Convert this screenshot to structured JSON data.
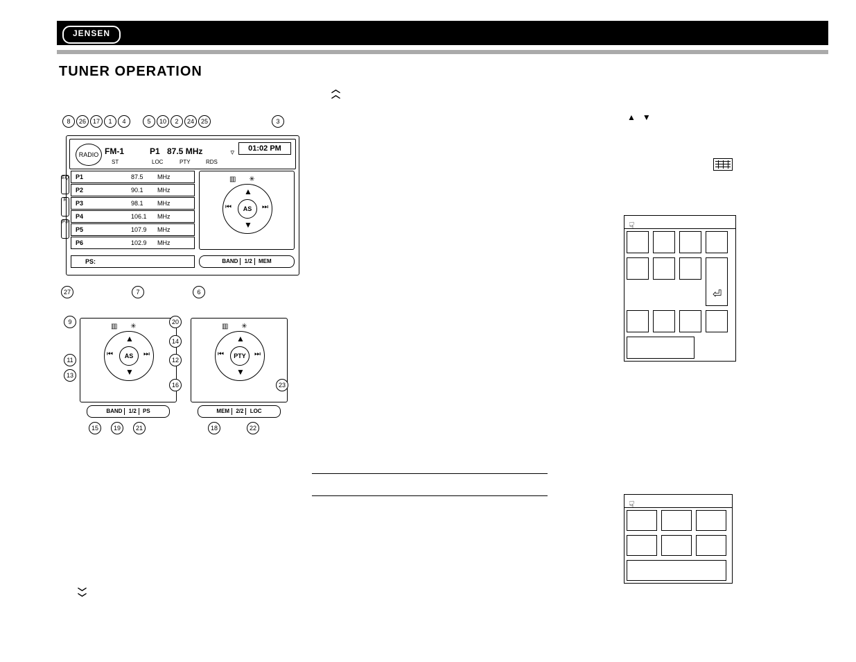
{
  "brand": "JENSEN",
  "page_title": "TUNER OPERATION",
  "radio": {
    "mode_label": "RADIO",
    "band": "FM-1",
    "preset_num": "P1",
    "frequency": "87.5",
    "freq_unit": "MHz",
    "clock": "01:02 PM",
    "indicators": {
      "st": "ST",
      "loc": "LOC",
      "pty": "PTY",
      "rds": "RDS"
    },
    "presets": [
      {
        "label": "P1",
        "freq": "87.5",
        "unit": "MHz"
      },
      {
        "label": "P2",
        "freq": "90.1",
        "unit": "MHz"
      },
      {
        "label": "P3",
        "freq": "98.1",
        "unit": "MHz"
      },
      {
        "label": "P4",
        "freq": "106.1",
        "unit": "MHz"
      },
      {
        "label": "P5",
        "freq": "107.9",
        "unit": "MHz"
      },
      {
        "label": "P6",
        "freq": "102.9",
        "unit": "MHz"
      }
    ],
    "ps_label": "PS:",
    "side_tabs": [
      "EQ",
      "R",
      "P·P"
    ],
    "pill_main": {
      "a": "BAND",
      "b": "1/2",
      "c": "MEM"
    }
  },
  "dpad_main": {
    "center": "AS"
  },
  "card_left": {
    "center": "AS",
    "pill": {
      "a": "BAND",
      "b": "1/2",
      "c": "PS"
    }
  },
  "card_right": {
    "center": "PTY",
    "pill": {
      "a": "MEM",
      "b": "2/2",
      "c": "LOC"
    }
  },
  "callouts_top_row": [
    "8",
    "26",
    "17",
    "1",
    "4",
    "5",
    "10",
    "2",
    "24",
    "25",
    "3"
  ],
  "callouts_other": {
    "c27": "27",
    "c7": "7",
    "c6": "6",
    "c9": "9",
    "c20": "20",
    "c14": "14",
    "c11": "11",
    "c12": "12",
    "c13": "13",
    "c16": "16",
    "c23": "23",
    "c15": "15",
    "c19": "19",
    "c21": "21",
    "c18": "18",
    "c22": "22"
  }
}
